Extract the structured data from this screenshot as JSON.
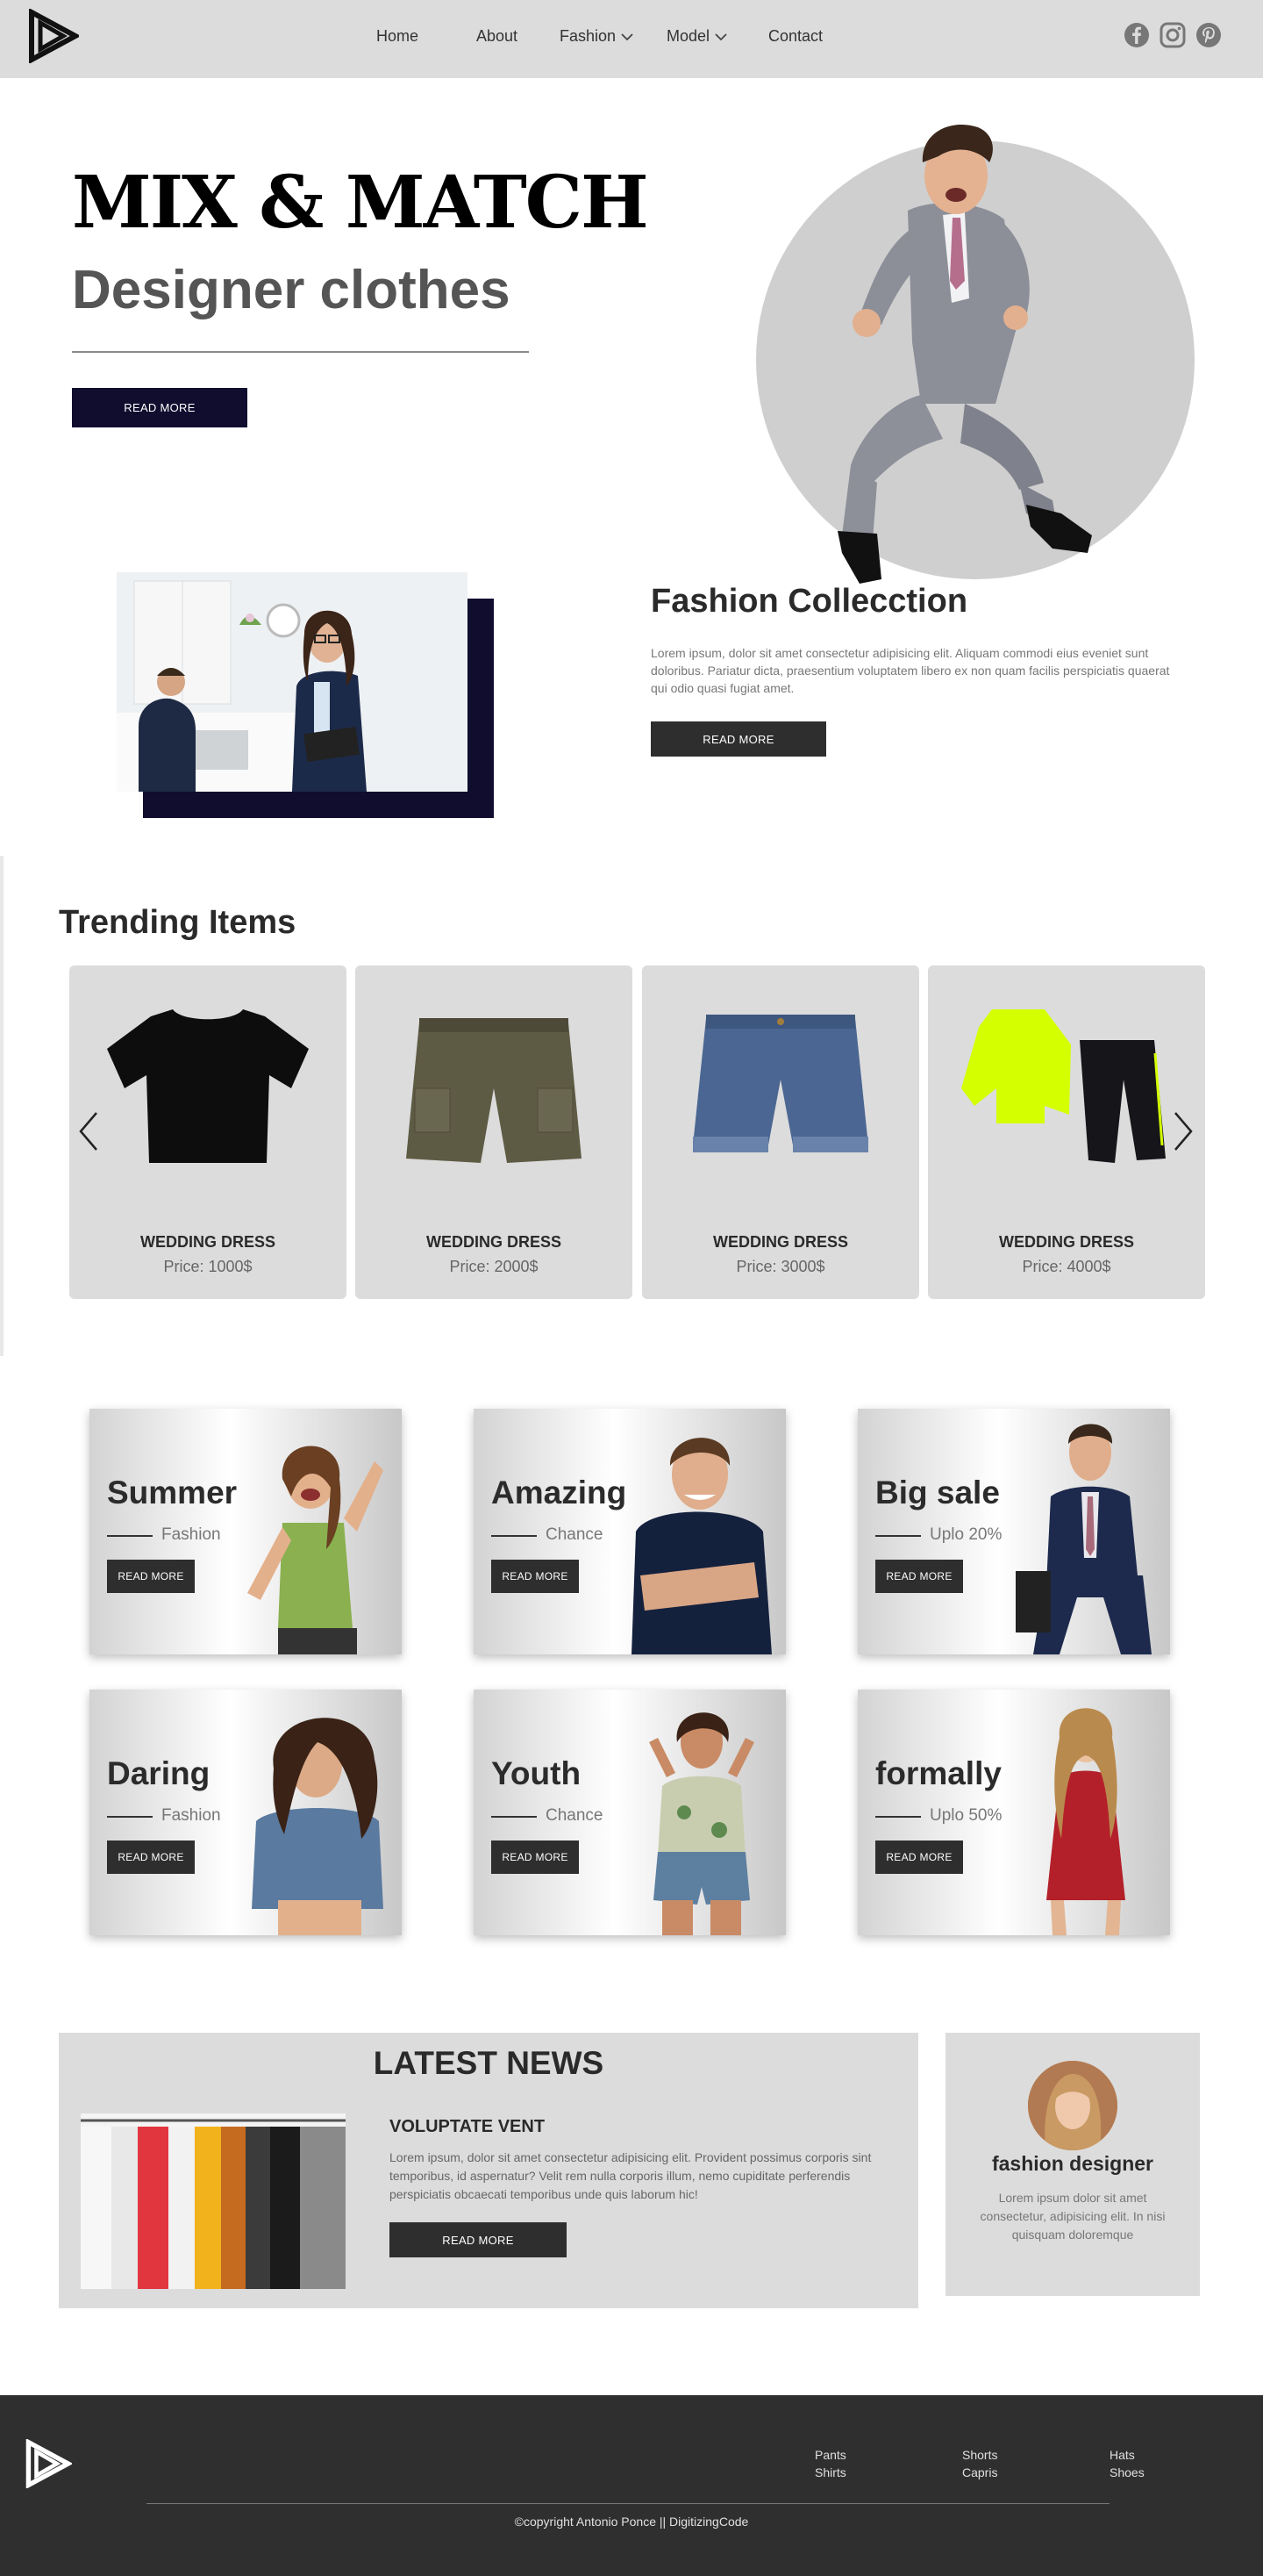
{
  "nav": {
    "items": [
      {
        "label": "Home"
      },
      {
        "label": "About"
      },
      {
        "label": "Fashion"
      },
      {
        "label": "Model"
      },
      {
        "label": "Contact"
      }
    ],
    "social_icons": [
      "facebook-icon",
      "instagram-icon",
      "pinterest-icon"
    ]
  },
  "hero": {
    "title": "MIX & MATCH",
    "subtitle": "Designer clothes",
    "button": "READ MORE"
  },
  "collection": {
    "title": "Fashion Collecction",
    "text": "Lorem ipsum, dolor sit amet consectetur adipisicing elit. Aliquam commodi eius eveniet sunt doloribus. Pariatur dicta, praesentium voluptatem libero ex non quam facilis perspiciatis quaerat qui odio quasi fugiat amet.",
    "button": "READ MORE"
  },
  "trending": {
    "title": "Trending Items",
    "items": [
      {
        "name": "WEDDING DRESS",
        "price": "Price: 1000$",
        "image": "t-shirt"
      },
      {
        "name": "WEDDING DRESS",
        "price": "Price: 2000$",
        "image": "cargo-shorts"
      },
      {
        "name": "WEDDING DRESS",
        "price": "Price: 3000$",
        "image": "denim-shorts"
      },
      {
        "name": "WEDDING DRESS",
        "price": "Price: 4000$",
        "image": "tracksuit"
      }
    ]
  },
  "promos": [
    {
      "title": "Summer",
      "sub": "Fashion",
      "button": "READ MORE"
    },
    {
      "title": "Amazing",
      "sub": "Chance",
      "button": "READ MORE"
    },
    {
      "title": "Big sale",
      "sub": "Uplo 20%",
      "button": "READ MORE"
    },
    {
      "title": "Daring",
      "sub": "Fashion",
      "button": "READ MORE"
    },
    {
      "title": "Youth",
      "sub": "Chance",
      "button": "READ MORE"
    },
    {
      "title": "formally",
      "sub": "Uplo 50%",
      "button": "READ MORE"
    }
  ],
  "news": {
    "title": "LATEST NEWS",
    "headline": "VOLUPTATE VENT",
    "text": "Lorem ipsum, dolor sit amet consectetur adipisicing elit. Provident possimus corporis sint temporibus, id aspernatur? Velit rem nulla corporis illum, nemo cupiditate perferendis perspiciatis obcaecati temporibus unde quis laborum hic!",
    "button": "READ MORE"
  },
  "designer": {
    "name": "fashion designer",
    "text": "Lorem ipsum dolor sit amet consectetur, adipisicing elit. In nisi quisquam doloremque"
  },
  "footer": {
    "columns": [
      [
        "Pants",
        "Shirts"
      ],
      [
        "Shorts",
        "Capris"
      ],
      [
        "Hats",
        "Shoes"
      ]
    ],
    "copyright": "©copyright Antonio Ponce || DigitizingCode"
  },
  "colors": {
    "navy": "#100d2f",
    "dark": "#2e2e2e",
    "panel": "#dcdcdc",
    "footer": "#2f2f2f"
  }
}
